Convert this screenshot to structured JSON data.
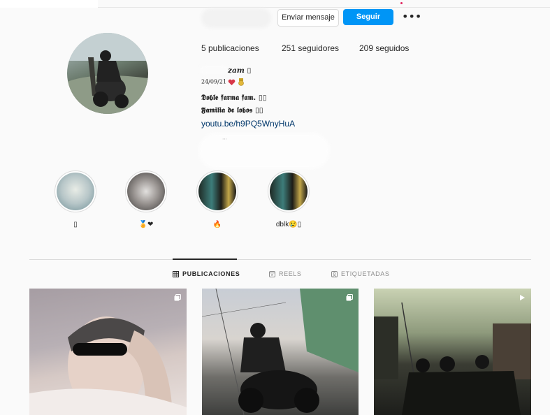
{
  "header": {
    "message_button": "Enviar mensaje",
    "follow_button": "Seguir",
    "more_button": "•••"
  },
  "stats": {
    "posts": "5 publicaciones",
    "followers": "251 seguidores",
    "following": "209 seguidos"
  },
  "bio": {
    "name_fragment": "zam ▯",
    "line1": "24/09/21",
    "line2": "𝕯𝖔𝖇𝖑𝖊 𝖋𝖆𝖗𝖒𝖆 𝖋𝖆𝖒. ▯▯",
    "line3": "𝕱𝖆𝖒𝖎𝖑𝖎𝖆 𝖉𝖊 𝖑𝖔𝖇𝖔𝖘 ▯▯",
    "link": "youtu.be/h9PQ5WnyHuA"
  },
  "highlights": [
    {
      "label": "▯"
    },
    {
      "label": "🏅❤"
    },
    {
      "label": "🔥"
    },
    {
      "label": "dblk😢▯"
    }
  ],
  "tabs": [
    {
      "label": "PUBLICACIONES",
      "icon": "grid-icon",
      "active": true
    },
    {
      "label": "REELS",
      "icon": "reels-icon",
      "active": false
    },
    {
      "label": "ETIQUETADAS",
      "icon": "tagged-icon",
      "active": false
    }
  ],
  "colors": {
    "follow_button": "#0095f6",
    "link": "#00376b",
    "text": "#262626",
    "muted": "#8e8e8e",
    "border": "#dbdbdb"
  }
}
